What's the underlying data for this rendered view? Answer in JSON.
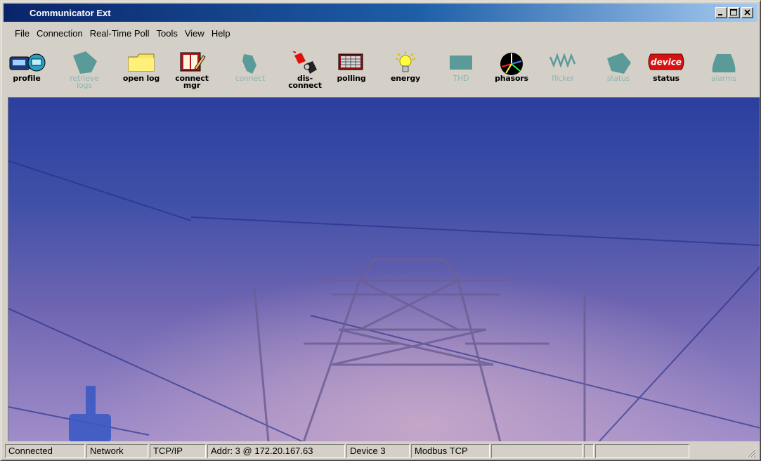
{
  "window": {
    "title": "Communicator Ext",
    "minimize_icon": "minimize-icon",
    "maximize_icon": "maximize-icon",
    "close_icon": "close-icon"
  },
  "menu": [
    "File",
    "Connection",
    "Real-Time Poll",
    "Tools",
    "View",
    "Help"
  ],
  "toolbar": [
    {
      "label": "profile",
      "icon": "meter-profile-icon",
      "enabled": true
    },
    {
      "label": "retrieve\nlogs",
      "icon": "retrieve-logs-icon",
      "enabled": false
    },
    {
      "label": "open log",
      "icon": "folder-icon",
      "enabled": true
    },
    {
      "label": "connect\nmgr",
      "icon": "address-book-icon",
      "enabled": true
    },
    {
      "label": "connect",
      "icon": "plug-icon",
      "enabled": false
    },
    {
      "label": "dis-\nconnect",
      "icon": "unplug-icon",
      "enabled": true
    },
    {
      "label": "polling",
      "icon": "polling-grid-icon",
      "enabled": true
    },
    {
      "label": "energy",
      "icon": "lightbulb-icon",
      "enabled": true
    },
    {
      "label": "THD",
      "icon": "thd-icon",
      "enabled": false
    },
    {
      "label": "phasors",
      "icon": "phasor-diagram-icon",
      "enabled": true
    },
    {
      "label": "flicker",
      "icon": "waveform-icon",
      "enabled": false
    },
    {
      "label": "status",
      "icon": "status-icon",
      "enabled": false
    },
    {
      "label": "status",
      "icon": "device-status-icon",
      "badge": "device",
      "enabled": true
    },
    {
      "label": "alarms",
      "icon": "alarm-icon",
      "enabled": false
    }
  ],
  "statusbar": {
    "panes": [
      "Connected",
      "Network",
      "TCP/IP",
      "Addr: 3 @ 172.20.167.63",
      "Device 3",
      "Modbus TCP",
      "",
      "",
      ""
    ]
  },
  "colors": {
    "title_gradient_start": "#0a246a",
    "title_gradient_end": "#a6caf0",
    "disabled_label": "#8fb4b4",
    "background_top": "#2b3f9e",
    "background_bottom": "#a08dc9"
  }
}
